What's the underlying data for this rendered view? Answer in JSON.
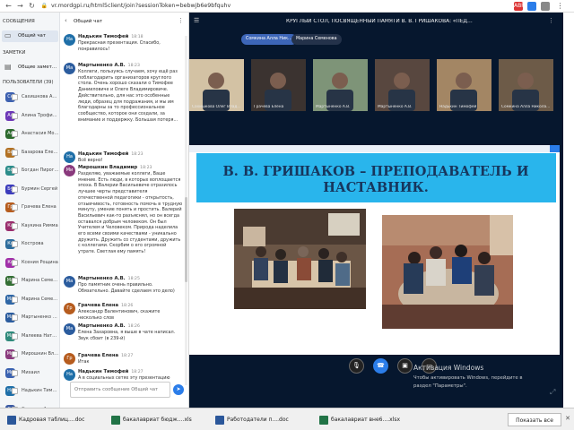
{
  "browser": {
    "url": "vr.mordgpi.ru/html5client/join?sessionToken=bebwjb6e9bfquhv",
    "nav": {
      "back": "←",
      "forward": "→",
      "reload": "↻",
      "lock": "🔒"
    },
    "extension_badge": "ABP"
  },
  "sidebar": {
    "messages_title": "СООБЩЕНИЯ",
    "public_chat": "Общий чат",
    "notes_title": "ЗАМЕТКИ",
    "shared_notes": "Общие заметки",
    "users_title": "ПОЛЬЗОВАТЕЛИ (39)",
    "users": [
      {
        "initials": "Се",
        "name": "Сахишкова Алла Ни...",
        "color": "#3d61b0"
      },
      {
        "initials": "Ал",
        "name": "Алина Трофимова",
        "color": "#6d38b7"
      },
      {
        "initials": "Ан",
        "name": "Анастасия Мотро...",
        "color": "#2c6a2d"
      },
      {
        "initials": "Ба",
        "name": "Базарова Елена...",
        "color": "#b27123"
      },
      {
        "initials": "Бо",
        "name": "Богдан Пирогов",
        "color": "#2c8d8b"
      },
      {
        "initials": "Бу",
        "name": "Бурмин Сергей",
        "color": "#3c3cbc"
      },
      {
        "initials": "Гр",
        "name": "Грачева Елена",
        "color": "#b65c1e"
      },
      {
        "initials": "Ка",
        "name": "Каукина Римма",
        "color": "#9a2d6d"
      },
      {
        "initials": "Ко",
        "name": "Кострова",
        "color": "#2d6c9c"
      },
      {
        "initials": "Кс",
        "name": "Ксения Рощина",
        "color": "#a02fa8"
      },
      {
        "initials": "Ма",
        "name": "Марина Семенова",
        "color": "#346f35"
      },
      {
        "initials": "Ма",
        "name": "Марина Семенова",
        "color": "#2f67a6"
      },
      {
        "initials": "Ма",
        "name": "Мартыненко А.В.",
        "color": "#2b5c9e"
      },
      {
        "initials": "Ма",
        "name": "Малеева Натальи...",
        "color": "#2f8a7b"
      },
      {
        "initials": "Ми",
        "name": "Мирошкин Влади...",
        "color": "#8a3a7d"
      },
      {
        "initials": "Ми",
        "name": "Михаил",
        "color": "#3b62b0"
      },
      {
        "initials": "На",
        "name": "Надькин Тимофей",
        "color": "#1f6fa8"
      },
      {
        "initials": "Со",
        "name": "Сомкина Алла Ник...",
        "color": "#3b5aa3"
      }
    ]
  },
  "chat": {
    "title": "Общий чат",
    "messages": [
      {
        "initials": "На",
        "author": "Надькин Тимофей",
        "time": "18:18",
        "color": "#1f6fa8",
        "text": "Прекрасная презентация. Спасибо, понравилось!"
      },
      {
        "initials": "Ма",
        "author": "Мартыненко А.В.",
        "time": "18:23",
        "color": "#2b5c9e",
        "text": "Коллеги, пользуясь случаем, хочу ещё раз поблагодарить организаторов круглого стола. Очень хорошо сказали о Тимофее Данииловиче и Олеге Владимировиче. Действительно, для нас это особенные люди, образец для подражания, и мы им благодарны за то профессиональное сообщество, которое они создали, за внимание и поддержку. Большая потеря..."
      },
      {
        "initials": "На",
        "author": "Надькин Тимофей",
        "time": "18:23",
        "color": "#1f6fa8",
        "text": "Всё верно!"
      },
      {
        "initials": "Ми",
        "author": "Мирошкин Владимир",
        "time": "18:23",
        "color": "#8a3a7d",
        "text": "Разделяю, уважаемые коллеги, Ваше мнение. Есть люди, в которых воплощается эпоха. В Валерии Васильевиче отразилось лучшее черты представителя отечественной педагогики - открытость, отзывчивость, готовность помочь в трудную минуту, умение понять и простить. Валерий Васильевич как-то разъяснял, но он всегда оставался добрым человеком. Он был Учителем и Человеком. Природа наделила его всеми своими качествами - уникально дружить. Дружить со студентами, дружить с коллегами. Скорбим о его огромной утрате. Светлая ему память!"
      },
      {
        "initials": "Ма",
        "author": "Мартыненко А.В.",
        "time": "18:25",
        "color": "#2b5c9e",
        "text": "Про памятник очень правильно. Обязательно. Давайте сделаем это дело)"
      },
      {
        "initials": "Гр",
        "author": "Грачева Елена",
        "time": "18:26",
        "color": "#b65c1e",
        "text": "Александр Валентинович, скажите несколько слов"
      },
      {
        "initials": "Ма",
        "author": "Мартыненко А.В.",
        "time": "18:26",
        "color": "#2b5c9e",
        "text": "Елена Захаровна, я выше в чате написал. Звук сбоит (в 239-й)"
      },
      {
        "initials": "Гр",
        "author": "Грачева Елена",
        "time": "18:27",
        "color": "#b65c1e",
        "text": "Итак"
      },
      {
        "initials": "На",
        "author": "Надькин Тимофей",
        "time": "18:27",
        "color": "#1f6fa8",
        "text": "А в социальных сетях эту презентацию можно разместить?"
      }
    ],
    "input_placeholder": "Отправить сообщение Общий чат"
  },
  "meeting": {
    "title": "КРУГЛЫЙ СТОЛ, ПОСВЯЩЕННЫЙ ПАМЯТИ В. В. ГРИШАКОВА: «ПЕДАГ...",
    "presenters": [
      "Сомкина Алла Ник...",
      "Марина Семенова"
    ],
    "tiles": [
      "Сахишкова Олег Влади...",
      "Грачева Елена",
      "Мартыненко А.В.",
      "Мартыненко А.В.",
      "Надькин Тимофей",
      "Сомкина Алла Николае..."
    ]
  },
  "slide": {
    "title": "В. В. ГРИШАКОВ – ПРЕПОДАВАТЕЛЬ И НАСТАВНИК."
  },
  "controls": {
    "mic": "mic",
    "phone": "phone",
    "camera": "camera",
    "screen": "screen"
  },
  "windows_activation": {
    "title": "Активация Windows",
    "line1": "Чтобы активировать Windows, перейдите в",
    "line2": "раздел \"Параметры\"."
  },
  "taskbar": {
    "items": [
      {
        "label": "Кадровая таблиц....doc",
        "color": "#2b579a"
      },
      {
        "label": "бакалавриат бюдж....xls",
        "color": "#217346"
      },
      {
        "label": "Работодатели п....doc",
        "color": "#2b579a"
      },
      {
        "label": "бакалавриат вне6....xlsx",
        "color": "#217346"
      }
    ],
    "show_all": "Показать все",
    "close": "✕"
  },
  "colors": {
    "meeting_bg": "#06172e",
    "accent": "#2b7de9",
    "slide_title": "#17365d"
  }
}
